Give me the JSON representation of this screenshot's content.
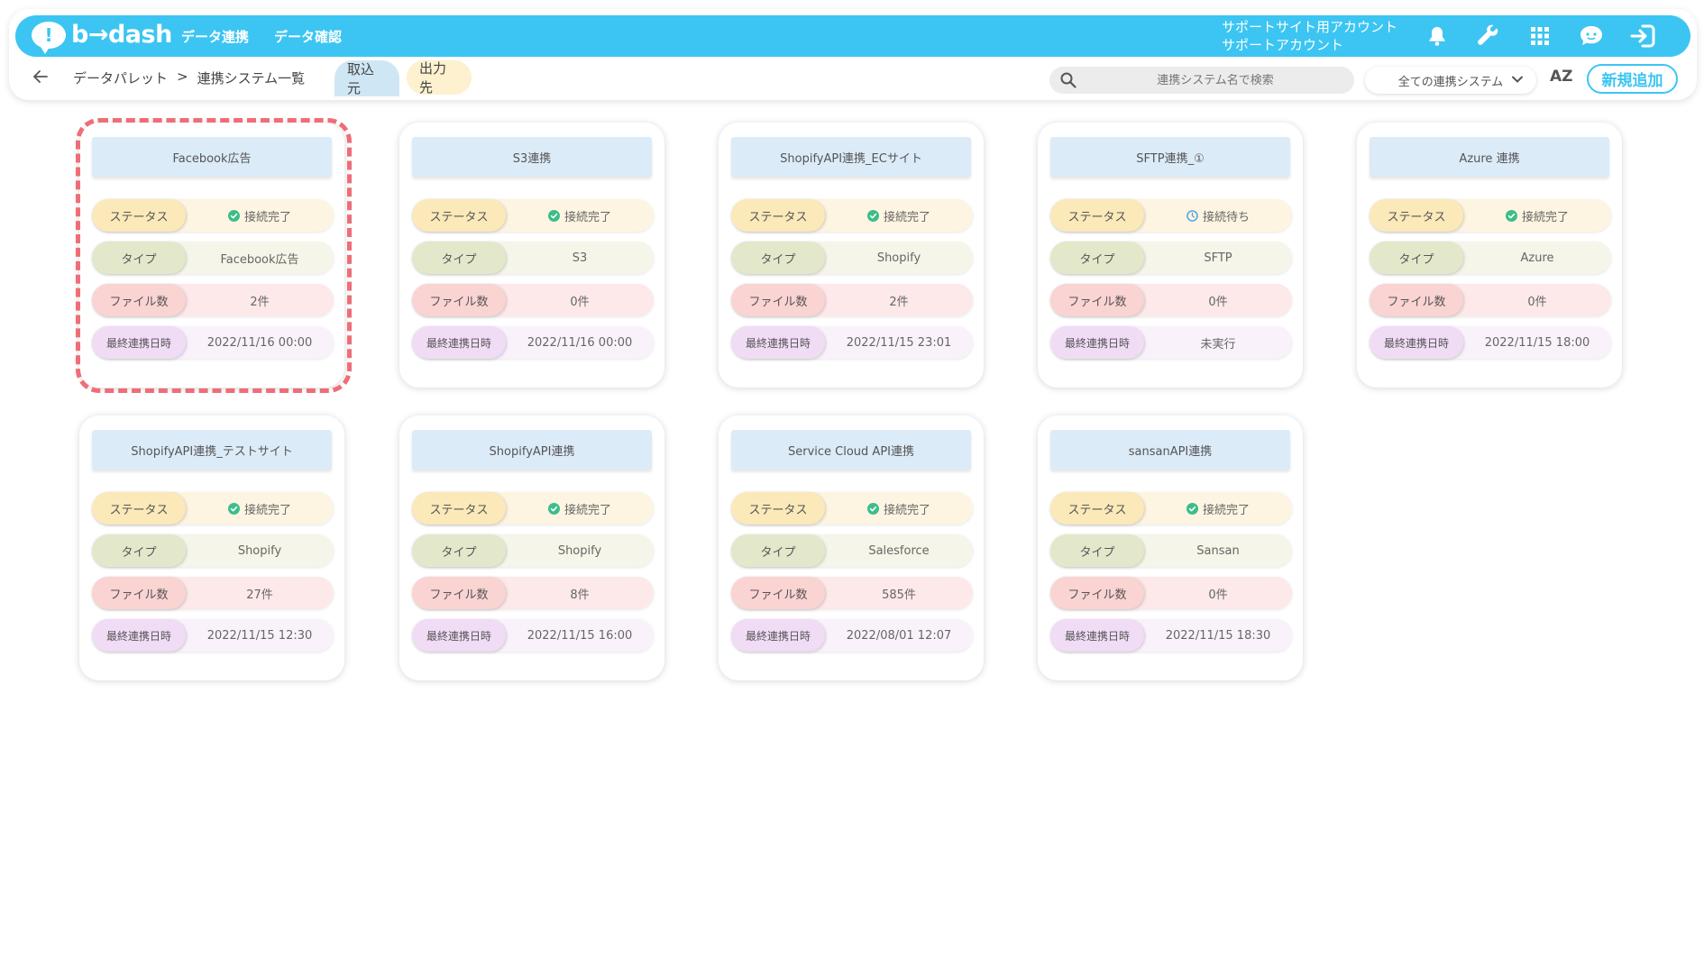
{
  "header": {
    "logo_text": "b→dash",
    "nav": [
      "データ連携",
      "データ確認"
    ],
    "account_line1": "サポートサイト用アカウント",
    "account_line2": "サポートアカウント",
    "accent_color": "#3cc5f2"
  },
  "subbar": {
    "breadcrumb_root": "データパレット",
    "breadcrumb_sep": ">",
    "breadcrumb_current": "連携システム一覧",
    "tab_import": "取込元",
    "tab_export": "出力先",
    "search_placeholder": "連携システム名で検索",
    "filter_selected": "全ての連携システム",
    "sort_label": "AZ",
    "new_button": "新規追加"
  },
  "labels": {
    "status": "ステータス",
    "type": "タイプ",
    "file_count": "ファイル数",
    "last_sync": "最終連携日時"
  },
  "cards": [
    {
      "title": "Facebook広告",
      "status": "接続完了",
      "status_kind": "connected",
      "type": "Facebook広告",
      "files": "2件",
      "last_sync": "2022/11/16 00:00",
      "highlighted": true
    },
    {
      "title": "S3連携",
      "status": "接続完了",
      "status_kind": "connected",
      "type": "S3",
      "files": "0件",
      "last_sync": "2022/11/16 00:00"
    },
    {
      "title": "ShopifyAPI連携_ECサイト",
      "status": "接続完了",
      "status_kind": "connected",
      "type": "Shopify",
      "files": "2件",
      "last_sync": "2022/11/15 23:01"
    },
    {
      "title": "SFTP連携_①",
      "status": "接続待ち",
      "status_kind": "waiting",
      "type": "SFTP",
      "files": "0件",
      "last_sync": "未実行"
    },
    {
      "title": "Azure 連携",
      "status": "接続完了",
      "status_kind": "connected",
      "type": "Azure",
      "files": "0件",
      "last_sync": "2022/11/15 18:00"
    },
    {
      "title": "ShopifyAPI連携_テストサイト",
      "status": "接続完了",
      "status_kind": "connected",
      "type": "Shopify",
      "files": "27件",
      "last_sync": "2022/11/15 12:30"
    },
    {
      "title": "ShopifyAPI連携",
      "status": "接続完了",
      "status_kind": "connected",
      "type": "Shopify",
      "files": "8件",
      "last_sync": "2022/11/15 16:00"
    },
    {
      "title": "Service Cloud API連携",
      "status": "接続完了",
      "status_kind": "connected",
      "type": "Salesforce",
      "files": "585件",
      "last_sync": "2022/08/01 12:07"
    },
    {
      "title": "sansanAPI連携",
      "status": "接続完了",
      "status_kind": "connected",
      "type": "Sansan",
      "files": "0件",
      "last_sync": "2022/11/15 18:30"
    }
  ],
  "status_colors": {
    "connected": "#3dbd8a",
    "waiting": "#57a9e0"
  },
  "icons": [
    "bell-icon",
    "wrench-icon",
    "grid-icon",
    "support-chat-icon",
    "logout-icon",
    "back-arrow-icon",
    "search-icon",
    "chevron-down-icon",
    "check-circle-icon"
  ]
}
